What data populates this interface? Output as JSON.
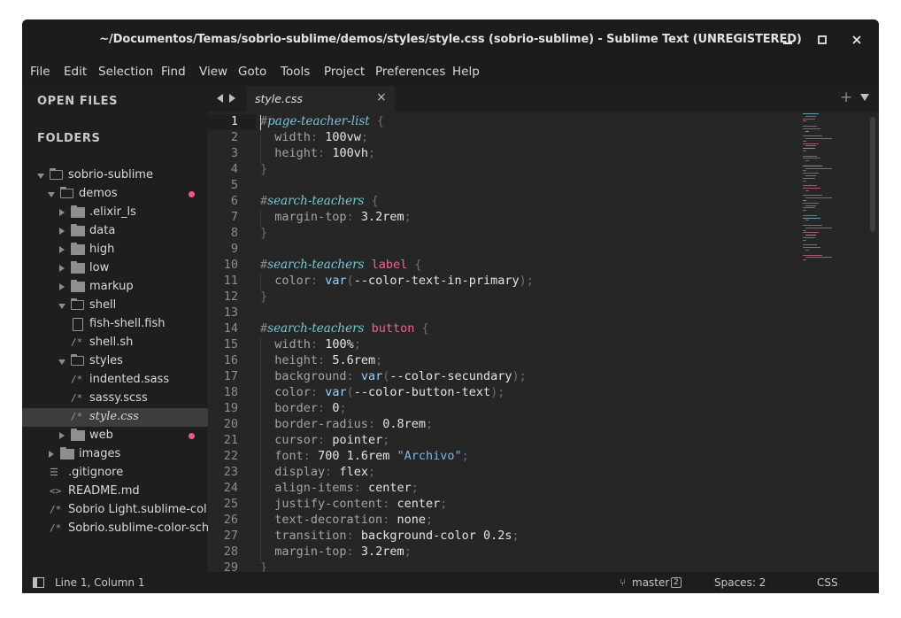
{
  "window": {
    "title": "~/Documentos/Temas/sobrio-sublime/demos/styles/style.css (sobrio-sublime) - Sublime Text (UNREGISTERED)",
    "controls": [
      "minimize-icon",
      "maximize-icon",
      "close-icon"
    ]
  },
  "menu": [
    "File",
    "Edit",
    "Selection",
    "Find",
    "View",
    "Goto",
    "Tools",
    "Project",
    "Preferences",
    "Help"
  ],
  "sidebar": {
    "open_files_label": "OPEN FILES",
    "folders_label": "FOLDERS",
    "items": [
      {
        "label": "sobrio-sublime",
        "type": "folder-open",
        "depth": 0
      },
      {
        "label": "demos",
        "type": "folder-open",
        "depth": 1,
        "modified": true
      },
      {
        "label": ".elixir_ls",
        "type": "folder",
        "depth": 2
      },
      {
        "label": "data",
        "type": "folder",
        "depth": 2
      },
      {
        "label": "high",
        "type": "folder",
        "depth": 2
      },
      {
        "label": "low",
        "type": "folder",
        "depth": 2
      },
      {
        "label": "markup",
        "type": "folder",
        "depth": 2
      },
      {
        "label": "shell",
        "type": "folder-open",
        "depth": 2
      },
      {
        "label": "fish-shell.fish",
        "type": "file",
        "depth": 3
      },
      {
        "label": "shell.sh",
        "type": "comment-file",
        "depth": 3
      },
      {
        "label": "styles",
        "type": "folder-open",
        "depth": 2
      },
      {
        "label": "indented.sass",
        "type": "comment-file",
        "depth": 3
      },
      {
        "label": "sassy.scss",
        "type": "comment-file",
        "depth": 3
      },
      {
        "label": "style.css",
        "type": "comment-file",
        "depth": 3,
        "selected": true
      },
      {
        "label": "web",
        "type": "folder",
        "depth": 2,
        "modified": true
      },
      {
        "label": "images",
        "type": "folder",
        "depth": 1
      },
      {
        "label": ".gitignore",
        "type": "list-file",
        "depth": 1
      },
      {
        "label": "README.md",
        "type": "markup-file",
        "depth": 1
      },
      {
        "label": "Sobrio Light.sublime-col",
        "type": "comment-file",
        "depth": 1
      },
      {
        "label": "Sobrio.sublime-color-sch",
        "type": "comment-file",
        "depth": 1
      }
    ]
  },
  "tab": {
    "title": "style.css"
  },
  "editor": {
    "lines": [
      [
        [
          "hash",
          "#"
        ],
        [
          "sel",
          "page-teacher-list"
        ],
        [
          "pl",
          " "
        ],
        [
          "brace",
          "{"
        ]
      ],
      [
        [
          "pl",
          "  "
        ],
        [
          "prop",
          "width"
        ],
        [
          "brace",
          ":"
        ],
        [
          "pl",
          " "
        ],
        [
          "num",
          "100vw"
        ],
        [
          "brace",
          ";"
        ]
      ],
      [
        [
          "pl",
          "  "
        ],
        [
          "prop",
          "height"
        ],
        [
          "brace",
          ":"
        ],
        [
          "pl",
          " "
        ],
        [
          "num",
          "100vh"
        ],
        [
          "brace",
          ";"
        ]
      ],
      [
        [
          "brace",
          "}"
        ]
      ],
      [],
      [
        [
          "hash",
          "#"
        ],
        [
          "sel",
          "search-teachers"
        ],
        [
          "pl",
          " "
        ],
        [
          "brace",
          "{"
        ]
      ],
      [
        [
          "pl",
          "  "
        ],
        [
          "prop",
          "margin-top"
        ],
        [
          "brace",
          ":"
        ],
        [
          "pl",
          " "
        ],
        [
          "num",
          "3.2rem"
        ],
        [
          "brace",
          ";"
        ]
      ],
      [
        [
          "brace",
          "}"
        ]
      ],
      [],
      [
        [
          "hash",
          "#"
        ],
        [
          "sel",
          "search-teachers"
        ],
        [
          "pl",
          " "
        ],
        [
          "tag",
          "label"
        ],
        [
          "pl",
          " "
        ],
        [
          "brace",
          "{"
        ]
      ],
      [
        [
          "pl",
          "  "
        ],
        [
          "prop",
          "color"
        ],
        [
          "brace",
          ":"
        ],
        [
          "pl",
          " "
        ],
        [
          "fn",
          "var"
        ],
        [
          "brace",
          "("
        ],
        [
          "val",
          "--color-text-in-primary"
        ],
        [
          "brace",
          ");"
        ]
      ],
      [
        [
          "brace",
          "}"
        ]
      ],
      [],
      [
        [
          "hash",
          "#"
        ],
        [
          "sel",
          "search-teachers"
        ],
        [
          "pl",
          " "
        ],
        [
          "tag",
          "button"
        ],
        [
          "pl",
          " "
        ],
        [
          "brace",
          "{"
        ]
      ],
      [
        [
          "pl",
          "  "
        ],
        [
          "prop",
          "width"
        ],
        [
          "brace",
          ":"
        ],
        [
          "pl",
          " "
        ],
        [
          "num",
          "100%"
        ],
        [
          "brace",
          ";"
        ]
      ],
      [
        [
          "pl",
          "  "
        ],
        [
          "prop",
          "height"
        ],
        [
          "brace",
          ":"
        ],
        [
          "pl",
          " "
        ],
        [
          "num",
          "5.6rem"
        ],
        [
          "brace",
          ";"
        ]
      ],
      [
        [
          "pl",
          "  "
        ],
        [
          "prop",
          "background"
        ],
        [
          "brace",
          ":"
        ],
        [
          "pl",
          " "
        ],
        [
          "fn",
          "var"
        ],
        [
          "brace",
          "("
        ],
        [
          "val",
          "--color-secundary"
        ],
        [
          "brace",
          ");"
        ]
      ],
      [
        [
          "pl",
          "  "
        ],
        [
          "prop",
          "color"
        ],
        [
          "brace",
          ":"
        ],
        [
          "pl",
          " "
        ],
        [
          "fn",
          "var"
        ],
        [
          "brace",
          "("
        ],
        [
          "val",
          "--color-button-text"
        ],
        [
          "brace",
          ");"
        ]
      ],
      [
        [
          "pl",
          "  "
        ],
        [
          "prop",
          "border"
        ],
        [
          "brace",
          ":"
        ],
        [
          "pl",
          " "
        ],
        [
          "num",
          "0"
        ],
        [
          "brace",
          ";"
        ]
      ],
      [
        [
          "pl",
          "  "
        ],
        [
          "prop",
          "border-radius"
        ],
        [
          "brace",
          ":"
        ],
        [
          "pl",
          " "
        ],
        [
          "num",
          "0.8rem"
        ],
        [
          "brace",
          ";"
        ]
      ],
      [
        [
          "pl",
          "  "
        ],
        [
          "prop",
          "cursor"
        ],
        [
          "brace",
          ":"
        ],
        [
          "pl",
          " "
        ],
        [
          "val",
          "pointer"
        ],
        [
          "brace",
          ";"
        ]
      ],
      [
        [
          "pl",
          "  "
        ],
        [
          "prop",
          "font"
        ],
        [
          "brace",
          ":"
        ],
        [
          "pl",
          " "
        ],
        [
          "num",
          "700 1.6rem"
        ],
        [
          "pl",
          " "
        ],
        [
          "str",
          "\"Archivo\""
        ],
        [
          "brace",
          ";"
        ]
      ],
      [
        [
          "pl",
          "  "
        ],
        [
          "prop",
          "display"
        ],
        [
          "brace",
          ":"
        ],
        [
          "pl",
          " "
        ],
        [
          "val",
          "flex"
        ],
        [
          "brace",
          ";"
        ]
      ],
      [
        [
          "pl",
          "  "
        ],
        [
          "prop",
          "align-items"
        ],
        [
          "brace",
          ":"
        ],
        [
          "pl",
          " "
        ],
        [
          "val",
          "center"
        ],
        [
          "brace",
          ";"
        ]
      ],
      [
        [
          "pl",
          "  "
        ],
        [
          "prop",
          "justify-content"
        ],
        [
          "brace",
          ":"
        ],
        [
          "pl",
          " "
        ],
        [
          "val",
          "center"
        ],
        [
          "brace",
          ";"
        ]
      ],
      [
        [
          "pl",
          "  "
        ],
        [
          "prop",
          "text-decoration"
        ],
        [
          "brace",
          ":"
        ],
        [
          "pl",
          " "
        ],
        [
          "val",
          "none"
        ],
        [
          "brace",
          ";"
        ]
      ],
      [
        [
          "pl",
          "  "
        ],
        [
          "prop",
          "transition"
        ],
        [
          "brace",
          ":"
        ],
        [
          "pl",
          " "
        ],
        [
          "val",
          "background-color 0.2s"
        ],
        [
          "brace",
          ";"
        ]
      ],
      [
        [
          "pl",
          "  "
        ],
        [
          "prop",
          "margin-top"
        ],
        [
          "brace",
          ":"
        ],
        [
          "pl",
          " "
        ],
        [
          "num",
          "3.2rem"
        ],
        [
          "brace",
          ";"
        ]
      ],
      [
        [
          "brace",
          "}"
        ]
      ]
    ],
    "current_line": 1
  },
  "status": {
    "position": "Line 1, Column 1",
    "branch": "master",
    "branch_count": "2",
    "spaces": "Spaces: 2",
    "syntax": "CSS"
  }
}
